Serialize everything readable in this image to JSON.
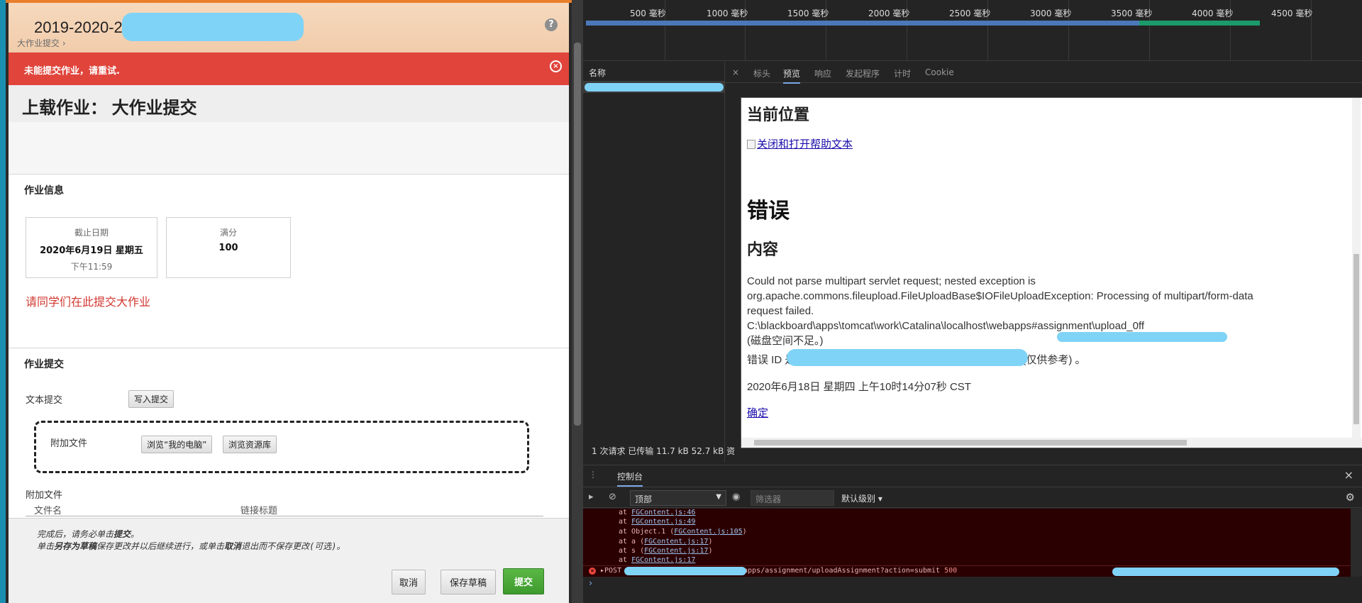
{
  "left": {
    "course_title": "2019-2020-2",
    "breadcrumb": "大作业提交",
    "help_icon": "?",
    "error_banner": {
      "message": "未能提交作业，请重试.",
      "close_icon": "×"
    },
    "page_title": "上载作业：  大作业提交",
    "info_section": {
      "heading": "作业信息",
      "due": {
        "label": "截止日期",
        "date": "2020年6月19日 星期五",
        "time": "下午11:59"
      },
      "points": {
        "label": "满分",
        "value": "100"
      },
      "notice": "请同学们在此提交大作业"
    },
    "submission": {
      "heading": "作业提交",
      "text_label": "文本提交",
      "write_button": "写入提交",
      "attach_label": "附加文件",
      "browse_pc": "浏览“我的电脑”",
      "browse_repo": "浏览资源库",
      "attached_files_label": "附加文件",
      "col_filename": "文件名",
      "col_link_title": "链接标题"
    },
    "footer": {
      "line1_pre": "完成后，请务必单击",
      "line1_bold": "提交",
      "line1_post": "。",
      "line2_a": "单击",
      "line2_b": "另存为草稿",
      "line2_c": "保存更改并以后继续进行，或单击",
      "line2_d": "取消",
      "line2_e": "退出而不保存更改(可选)。",
      "cancel": "取消",
      "save_draft": "保存草稿",
      "submit": "提交"
    }
  },
  "devtools": {
    "timeline_ticks": [
      "500 毫秒",
      "1000 毫秒",
      "1500 毫秒",
      "2000 毫秒",
      "2500 毫秒",
      "3000 毫秒",
      "3500 毫秒",
      "4000 毫秒",
      "4500 毫秒"
    ],
    "name_header": "名称",
    "request_status": "1 次请求  已传输 11.7 kB  52.7 kB 资",
    "tabs": [
      "×",
      "标头",
      "预览",
      "响应",
      "发起程序",
      "计时",
      "Cookie"
    ],
    "active_tab": "预览",
    "preview": {
      "location": "当前位置",
      "help_link": "关闭和打开帮助文本",
      "error_title": "错误",
      "content_title": "内容",
      "message_l1": "Could not parse multipart servlet request; nested exception is",
      "message_l2": "org.apache.commons.fileupload.FileUploadBase$IOFileUploadException: Processing of multipart/form-data",
      "message_l3": "request failed.",
      "message_l4": "C:\\blackboard\\apps\\tomcat\\work\\Catalina\\localhost\\webapps#assignment\\upload_0ff",
      "message_l5": "(磁盘空间不足。)",
      "error_id_prefix": "错误 ID 是",
      "error_id_suffix": "(仅供参考) 。",
      "timestamp": "2020年6月18日 星期四 上午10时14分07秒 CST",
      "ok_link": "确定"
    },
    "console": {
      "dots": "⋮",
      "title": "控制台",
      "close": "×",
      "context": "顶部",
      "filter_placeholder": "筛选器",
      "level": "默认级别 ▾",
      "lines": [
        {
          "pre": "at ",
          "link": "FGContent.js:46",
          "post": ""
        },
        {
          "pre": "at ",
          "link": "FGContent.js:49",
          "post": ""
        },
        {
          "pre": "at Object.1 (",
          "link": "FGContent.js:105",
          "post": ")"
        },
        {
          "pre": "at a (",
          "link": "FGContent.js:17",
          "post": ")"
        },
        {
          "pre": "at s (",
          "link": "FGContent.js:17",
          "post": ")"
        },
        {
          "pre": "at ",
          "link": "FGContent.js:17",
          "post": ""
        }
      ],
      "error_method": "▸POST",
      "error_url": "apps/assignment/uploadAssignment?action=submit",
      "error_status": "500",
      "prompt": "›"
    }
  },
  "colors": {
    "error_red": "#e0443b",
    "submit_green": "#4cab3b",
    "notice_red": "#d2372f",
    "redaction_blue": "#7fd3f7"
  }
}
